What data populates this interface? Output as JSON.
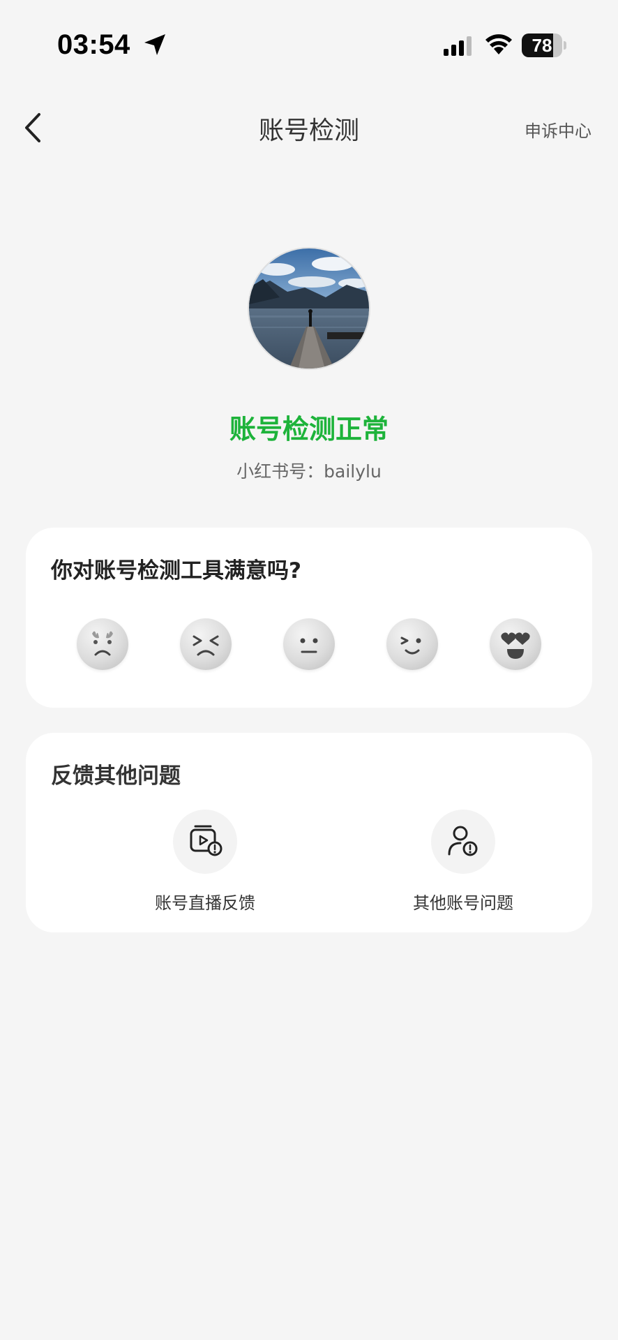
{
  "status_bar": {
    "time": "03:54",
    "battery": "78",
    "battery_level": 0.78
  },
  "nav": {
    "title": "账号检测",
    "appeal_label": "申诉中心"
  },
  "profile": {
    "status": "账号检测正常",
    "account_id": "小红书号：bailylu",
    "status_color": "#1db33a"
  },
  "survey": {
    "question": "你对账号检测工具满意吗?",
    "ratings": [
      "angry-face-icon",
      "frustrated-face-icon",
      "neutral-face-icon",
      "smiling-face-icon",
      "heart-eyes-face-icon"
    ]
  },
  "feedback": {
    "title": "反馈其他问题",
    "items": [
      {
        "label": "账号直播反馈",
        "icon": "live-video-alert-icon"
      },
      {
        "label": "其他账号问题",
        "icon": "user-alert-icon"
      }
    ]
  }
}
